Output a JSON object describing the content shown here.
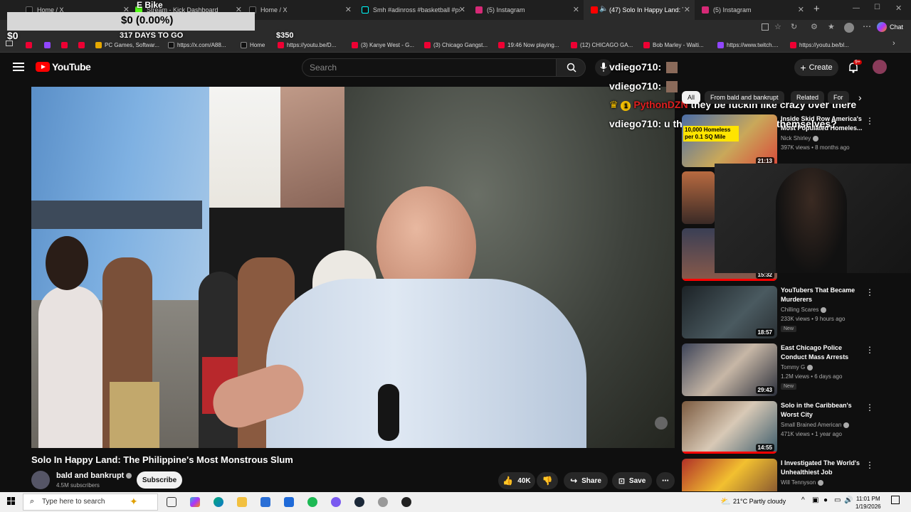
{
  "browser": {
    "tabs": [
      {
        "label": "Home / X",
        "color": "#111111",
        "active": false
      },
      {
        "label": "Stream - Kick Dashboard",
        "color": "#53fc18",
        "active": false
      },
      {
        "label": "Home / X",
        "color": "#111111",
        "active": false
      },
      {
        "label": "Smh #adinross #basketball #psyc",
        "color": "#111111",
        "active": false
      },
      {
        "label": "(5) Instagram",
        "color": "#d62976",
        "active": false
      },
      {
        "label": "(47) Solo In Happy Land: The",
        "color": "#ff0000",
        "active": true
      },
      {
        "label": "(5) Instagram",
        "color": "#d62976",
        "active": false
      }
    ],
    "chat_button": "Chat",
    "bookmarks": [
      {
        "label": ""
      },
      {
        "label": ""
      },
      {
        "label": ""
      },
      {
        "label": ""
      },
      {
        "label": "PC Games, Softwar..."
      },
      {
        "label": "https://x.com/A88..."
      },
      {
        "label": "Home"
      },
      {
        "label": "https://youtu.be/D..."
      },
      {
        "label": "(3) Kanye West - G..."
      },
      {
        "label": "(3) Chicago Gangst..."
      },
      {
        "label": "19:46 Now playing..."
      },
      {
        "label": "(12) CHICAGO GA..."
      },
      {
        "label": "Bob Marley - Waiti..."
      },
      {
        "label": "https://www.twitch...."
      },
      {
        "label": "https://youtu.be/bl..."
      }
    ]
  },
  "stream_overlay": {
    "title": "E Bike",
    "amount": "$0 (0.00%)",
    "left_value": "$0",
    "days_to_go": "317 DAYS TO GO",
    "goal": "$350"
  },
  "youtube": {
    "logo_text": "YouTube",
    "search_placeholder": "Search",
    "create_label": "Create",
    "notifications_badge": "9+",
    "video_title": "Solo In Happy Land: The Philippine's Most Monstrous Slum",
    "channel_name": "bald and bankrupt",
    "subscribers": "4.5M subscribers",
    "subscribe_label": "Subscribe",
    "likes": "40K",
    "share_label": "Share",
    "save_label": "Save",
    "chips": [
      "All",
      "From bald and bankrupt",
      "Related",
      "For"
    ],
    "related": [
      {
        "title": "Inside Skid Row America's Most Populated Homeles...",
        "channel": "Nick Shirley",
        "views": "397K views • 8 months ago",
        "duration": "21:13",
        "new": "",
        "thumb_text": "10,000 Homeless per 0.1 SQ Mile"
      },
      {
        "title": "",
        "channel": "",
        "views": "",
        "duration": "",
        "new": "",
        "thumb_text": ""
      },
      {
        "title": "",
        "channel": "",
        "views": "",
        "duration": "15:32",
        "new": "",
        "thumb_text": ""
      },
      {
        "title": "YouTubers That Became Murderers",
        "channel": "Chilling Scares",
        "views": "233K views • 9 hours ago",
        "duration": "18:57",
        "new": "New",
        "thumb_text": ""
      },
      {
        "title": "East Chicago Police Conduct Mass Arrests",
        "channel": "Tommy G",
        "views": "1.2M views • 6 days ago",
        "duration": "29:43",
        "new": "New",
        "thumb_text": ""
      },
      {
        "title": "Solo in the Caribbean's Worst City",
        "channel": "Small Brained American",
        "views": "471K views • 1 year ago",
        "duration": "14:55",
        "new": "",
        "thumb_text": ""
      },
      {
        "title": "I Investigated The World's Unhealthiest Job",
        "channel": "Will Tennyson",
        "views": "",
        "duration": "",
        "new": "",
        "thumb_text": ""
      }
    ]
  },
  "chat_messages": [
    {
      "user": "vdiego710:",
      "text": ""
    },
    {
      "user": "vdiego710:",
      "text": ""
    },
    {
      "user": "PythonDZN",
      "badge": "1",
      "text": "they be fuckin like crazy over there"
    },
    {
      "user": "vdiego710:",
      "text": "u think they wanna flax themselves?"
    }
  ],
  "taskbar": {
    "search_placeholder": "Type here to search",
    "weather": "21°C  Partly cloudy",
    "time": "11:01 PM",
    "date": "1/19/2026"
  }
}
